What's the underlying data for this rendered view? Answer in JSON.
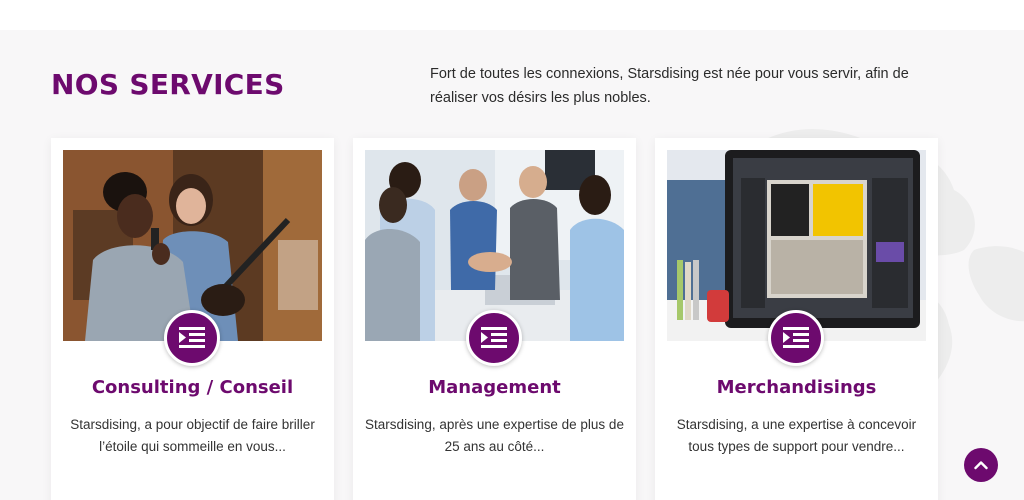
{
  "section": {
    "title": "NOS SERVICES",
    "intro": "Fort de toutes les connexions, Starsdising est née pour vous servir, afin de réaliser vos désirs les plus nobles."
  },
  "services": [
    {
      "title": "Consulting / Conseil",
      "description": "Starsdising, a pour objectif de faire briller l’étoile qui sommeille en vous...",
      "icon": "menu-indent-icon"
    },
    {
      "title": "Management",
      "description": "Starsdising, après une expertise de plus de 25 ans au côté...",
      "icon": "menu-indent-icon"
    },
    {
      "title": "Merchandisings",
      "description": "Starsdising, a une expertise à concevoir tous types de support pour vendre...",
      "icon": "menu-indent-icon"
    }
  ],
  "colors": {
    "accent": "#6d0a6e",
    "background": "#f8f7f8",
    "card": "#ffffff"
  },
  "scroll_top": {
    "icon": "chevron-up-icon"
  }
}
